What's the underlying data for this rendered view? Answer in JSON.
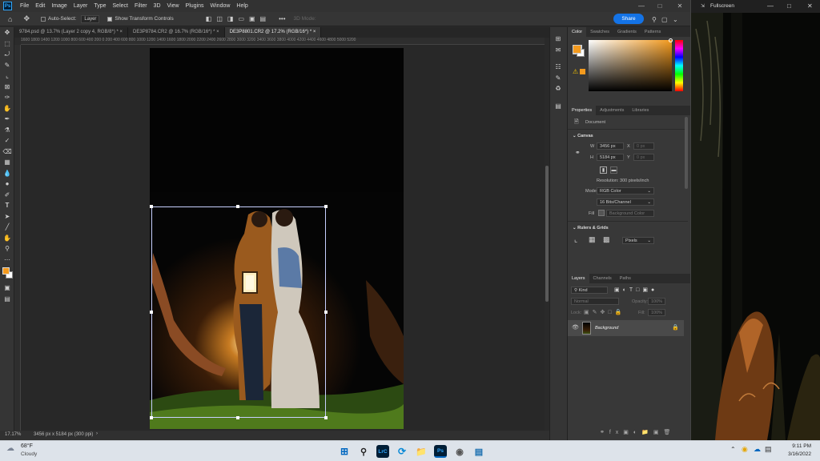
{
  "menus": [
    "File",
    "Edit",
    "Image",
    "Layer",
    "Type",
    "Select",
    "Filter",
    "3D",
    "View",
    "Plugins",
    "Window",
    "Help"
  ],
  "options": {
    "auto_select": "Auto-Select:",
    "layer_select": "Layer",
    "show_transform": "Show Transform Controls",
    "mode_3d": "3D Mode:",
    "share": "Share"
  },
  "tabs": [
    "9784.psd @ 13.7% (Layer 2 copy 4, RGB/8*) *",
    "DE3P8784.CR2 @ 16.7% (RGB/16*) *",
    "DE3P8801.CR2 @ 17.2% (RGB/16*) *"
  ],
  "ruler_ticks": "1600  1800  1400  1200  1000  800  600  400  200  0  200  400  600  800  1000  1200  1400  1600  1800  2000  2200  2400  2600  2800  3000  3200  3400  3600  3800  4000  4200  4400  4600  4800  5000  5200",
  "status": {
    "zoom": "17.17%",
    "doc": "3456 px x 5184 px (300 ppi)"
  },
  "color_panel": {
    "tabs": [
      "Color",
      "Swatches",
      "Gradients",
      "Patterns"
    ],
    "fg": "#f39a1e",
    "bg": "#ffffff"
  },
  "properties": {
    "tabs": [
      "Properties",
      "Adjustments",
      "Libraries"
    ],
    "doc_label": "Document",
    "canvas_header": "Canvas",
    "w_label": "W",
    "w_value": "3456 px",
    "h_label": "H",
    "h_value": "5184 px",
    "x_label": "X",
    "x_value": "0 px",
    "y_label": "Y",
    "y_value": "0 px",
    "resolution": "Resolution: 300 pixels/inch",
    "mode_label": "Mode",
    "mode_value": "RGB Color",
    "depth_value": "16 Bits/Channel",
    "fill_label": "Fill",
    "fill_value": "Background Color",
    "rulers_header": "Rulers & Grids",
    "units_value": "Pixels"
  },
  "layers": {
    "tabs": [
      "Layers",
      "Channels",
      "Paths"
    ],
    "kind": "Kind",
    "blend": "Normal",
    "opacity_label": "Opacity:",
    "opacity_value": "100%",
    "lock_label": "Lock:",
    "fill_label": "Fill:",
    "fill_value": "100%",
    "layer_name": "Background"
  },
  "fullscreen": {
    "label": "Fullscreen"
  },
  "weather": {
    "temp": "68°F",
    "cond": "Cloudy"
  },
  "clock": {
    "time": "9:11 PM",
    "date": "3/16/2022"
  }
}
